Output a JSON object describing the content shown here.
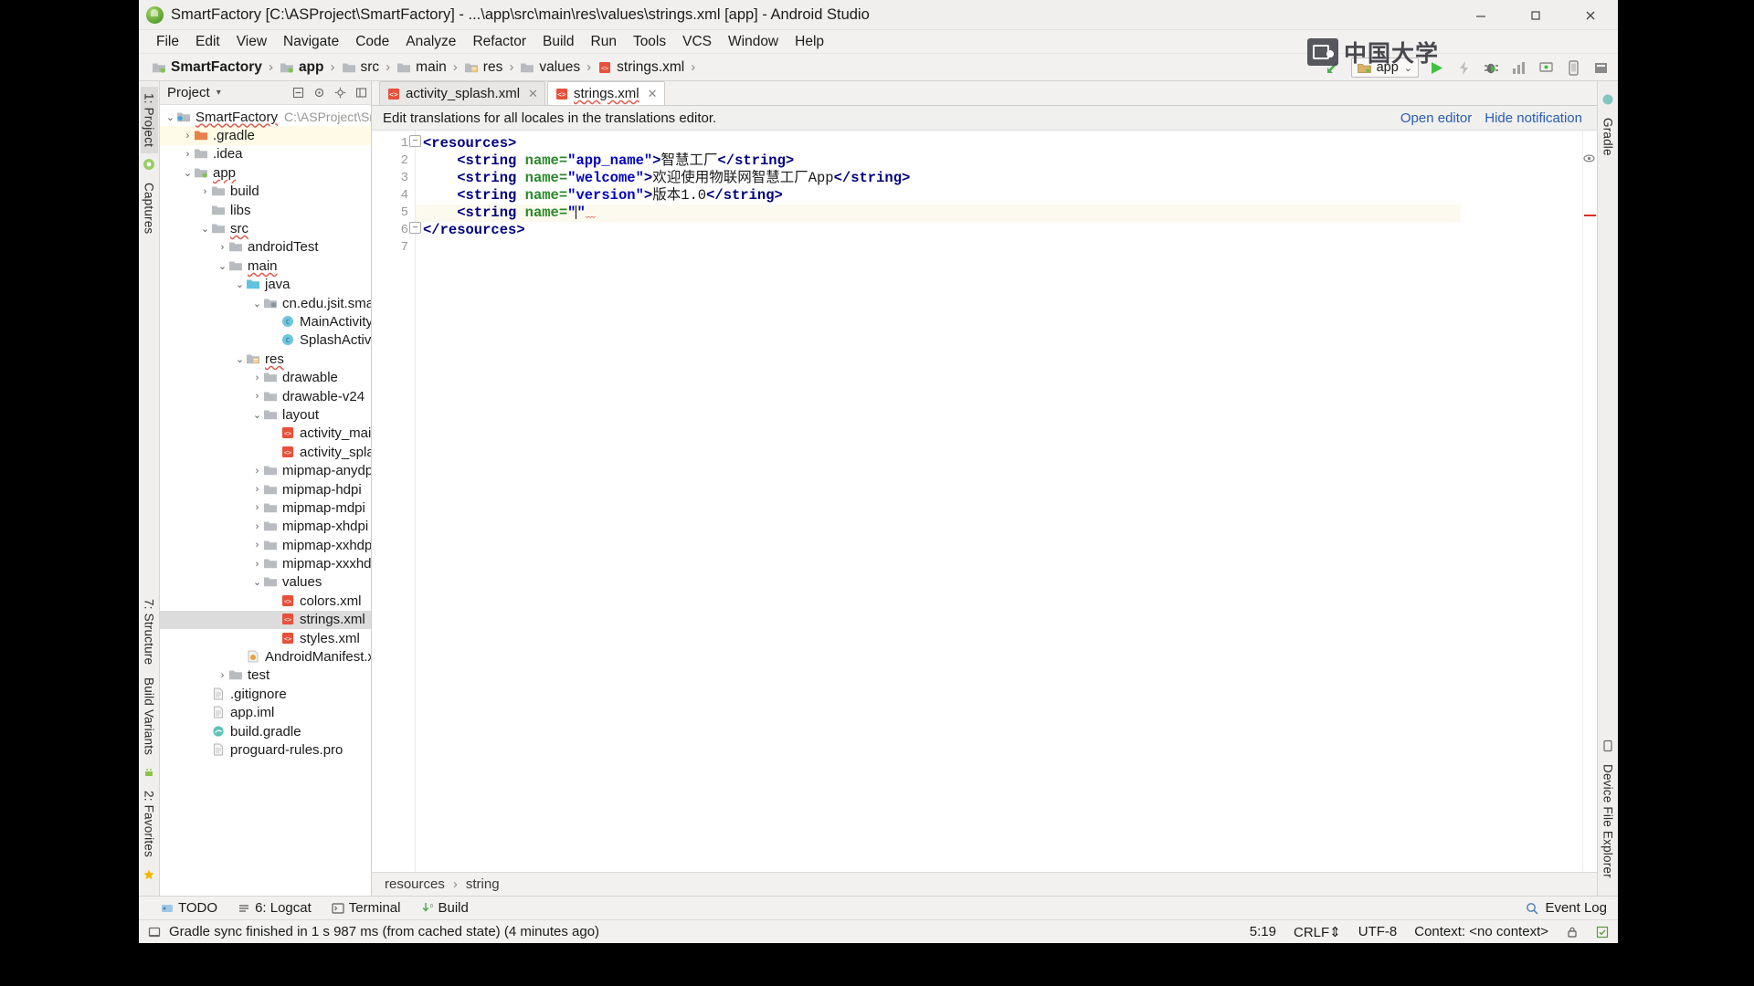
{
  "window": {
    "title": "SmartFactory [C:\\ASProject\\SmartFactory] - ...\\app\\src\\main\\res\\values\\strings.xml [app] - Android Studio",
    "minimize_label": "—",
    "maximize_label": "▢",
    "close_label": "✕"
  },
  "menubar": {
    "items": [
      "File",
      "Edit",
      "View",
      "Navigate",
      "Code",
      "Analyze",
      "Refactor",
      "Build",
      "Run",
      "Tools",
      "VCS",
      "Window",
      "Help"
    ]
  },
  "navbar": {
    "breadcrumbs": [
      {
        "label": "SmartFactory",
        "icon": "module-icon",
        "bold": true
      },
      {
        "label": "app",
        "icon": "module-icon",
        "bold": true
      },
      {
        "label": "src",
        "icon": "folder-icon",
        "bold": false
      },
      {
        "label": "main",
        "icon": "folder-icon",
        "bold": false
      },
      {
        "label": "res",
        "icon": "res-folder-icon",
        "bold": false
      },
      {
        "label": "values",
        "icon": "folder-icon",
        "bold": false
      },
      {
        "label": "strings.xml",
        "icon": "xml-file-icon",
        "bold": false
      }
    ],
    "run_config": "app",
    "icons": [
      "sync-project-icon",
      "run-icon",
      "apply-changes-icon",
      "debug-icon",
      "profiler-icon",
      "attach-debugger-icon",
      "avd-manager-icon",
      "sdk-manager-icon"
    ]
  },
  "left_strip": {
    "tabs": [
      {
        "label": "1: Project",
        "selected": true
      },
      {
        "label": "Captures",
        "selected": false
      },
      {
        "label": "7: Structure",
        "selected": false
      },
      {
        "label": "Build Variants",
        "selected": false
      },
      {
        "label": "2: Favorites",
        "selected": false
      }
    ]
  },
  "right_strip": {
    "tabs": [
      {
        "label": "Gradle"
      },
      {
        "label": "Device File Explorer"
      }
    ]
  },
  "project_panel": {
    "title": "Project",
    "actions": [
      "collapse-all-icon",
      "locate-icon",
      "settings-icon",
      "hide-icon"
    ],
    "tree": [
      {
        "label": "SmartFactory",
        "path": "C:\\ASProject\\Smar",
        "depth": 0,
        "arrow": "down",
        "icon": "project-icon",
        "state": "none",
        "wavy": true
      },
      {
        "label": ".gradle",
        "depth": 1,
        "arrow": "right",
        "icon": "gradle-folder-icon",
        "state": "yellow",
        "wavy": false
      },
      {
        "label": ".idea",
        "depth": 1,
        "arrow": "right",
        "icon": "folder-icon",
        "state": "none",
        "wavy": false
      },
      {
        "label": "app",
        "depth": 1,
        "arrow": "down",
        "icon": "module-icon",
        "state": "none",
        "wavy": true
      },
      {
        "label": "build",
        "depth": 2,
        "arrow": "right",
        "icon": "folder-icon",
        "state": "none",
        "wavy": false
      },
      {
        "label": "libs",
        "depth": 2,
        "arrow": "none",
        "icon": "folder-icon",
        "state": "none",
        "wavy": false
      },
      {
        "label": "src",
        "depth": 2,
        "arrow": "down",
        "icon": "folder-icon",
        "state": "none",
        "wavy": true
      },
      {
        "label": "androidTest",
        "depth": 3,
        "arrow": "right",
        "icon": "folder-icon",
        "state": "none",
        "wavy": false
      },
      {
        "label": "main",
        "depth": 3,
        "arrow": "down",
        "icon": "folder-icon",
        "state": "none",
        "wavy": true
      },
      {
        "label": "java",
        "depth": 4,
        "arrow": "down",
        "icon": "source-folder-icon",
        "state": "none",
        "wavy": false
      },
      {
        "label": "cn.edu.jsit.smar",
        "depth": 5,
        "arrow": "down",
        "icon": "package-icon",
        "state": "none",
        "wavy": false
      },
      {
        "label": "MainActivity",
        "depth": 6,
        "arrow": "none",
        "icon": "class-icon",
        "state": "none",
        "wavy": false
      },
      {
        "label": "SplashActivi",
        "depth": 6,
        "arrow": "none",
        "icon": "class-icon",
        "state": "none",
        "wavy": false
      },
      {
        "label": "res",
        "depth": 4,
        "arrow": "down",
        "icon": "res-folder-icon",
        "state": "none",
        "wavy": true
      },
      {
        "label": "drawable",
        "depth": 5,
        "arrow": "right",
        "icon": "folder-icon",
        "state": "none",
        "wavy": false
      },
      {
        "label": "drawable-v24",
        "depth": 5,
        "arrow": "right",
        "icon": "folder-icon",
        "state": "none",
        "wavy": false
      },
      {
        "label": "layout",
        "depth": 5,
        "arrow": "down",
        "icon": "folder-icon",
        "state": "none",
        "wavy": false
      },
      {
        "label": "activity_main",
        "depth": 6,
        "arrow": "none",
        "icon": "xml-file-icon",
        "state": "none",
        "wavy": false
      },
      {
        "label": "activity_spla",
        "depth": 6,
        "arrow": "none",
        "icon": "xml-file-icon",
        "state": "none",
        "wavy": false
      },
      {
        "label": "mipmap-anydpi",
        "depth": 5,
        "arrow": "right",
        "icon": "folder-icon",
        "state": "none",
        "wavy": false
      },
      {
        "label": "mipmap-hdpi",
        "depth": 5,
        "arrow": "right",
        "icon": "folder-icon",
        "state": "none",
        "wavy": false
      },
      {
        "label": "mipmap-mdpi",
        "depth": 5,
        "arrow": "right",
        "icon": "folder-icon",
        "state": "none",
        "wavy": false
      },
      {
        "label": "mipmap-xhdpi",
        "depth": 5,
        "arrow": "right",
        "icon": "folder-icon",
        "state": "none",
        "wavy": false
      },
      {
        "label": "mipmap-xxhdpi",
        "depth": 5,
        "arrow": "right",
        "icon": "folder-icon",
        "state": "none",
        "wavy": false
      },
      {
        "label": "mipmap-xxxhdp",
        "depth": 5,
        "arrow": "right",
        "icon": "folder-icon",
        "state": "none",
        "wavy": false
      },
      {
        "label": "values",
        "depth": 5,
        "arrow": "down",
        "icon": "folder-icon",
        "state": "none",
        "wavy": false
      },
      {
        "label": "colors.xml",
        "depth": 6,
        "arrow": "none",
        "icon": "xml-file-icon",
        "state": "none",
        "wavy": false
      },
      {
        "label": "strings.xml",
        "depth": 6,
        "arrow": "none",
        "icon": "xml-file-icon",
        "state": "grey",
        "wavy": false
      },
      {
        "label": "styles.xml",
        "depth": 6,
        "arrow": "none",
        "icon": "xml-file-icon",
        "state": "none",
        "wavy": false
      },
      {
        "label": "AndroidManifest.xm",
        "depth": 4,
        "arrow": "none",
        "icon": "manifest-icon",
        "state": "none",
        "wavy": false
      },
      {
        "label": "test",
        "depth": 3,
        "arrow": "right",
        "icon": "folder-icon",
        "state": "none",
        "wavy": false
      },
      {
        "label": ".gitignore",
        "depth": 2,
        "arrow": "none",
        "icon": "file-icon",
        "state": "none",
        "wavy": false
      },
      {
        "label": "app.iml",
        "depth": 2,
        "arrow": "none",
        "icon": "file-icon",
        "state": "none",
        "wavy": false
      },
      {
        "label": "build.gradle",
        "depth": 2,
        "arrow": "none",
        "icon": "gradle-file-icon",
        "state": "none",
        "wavy": false
      },
      {
        "label": "proguard-rules.pro",
        "depth": 2,
        "arrow": "none",
        "icon": "file-icon",
        "state": "none",
        "wavy": false
      }
    ]
  },
  "editor": {
    "tabs": [
      {
        "label": "activity_splash.xml",
        "active": false,
        "error": false,
        "icon": "xml-file-icon"
      },
      {
        "label": "strings.xml",
        "active": true,
        "error": true,
        "icon": "xml-file-icon"
      }
    ],
    "notification": {
      "message": "Edit translations for all locales in the translations editor.",
      "open_editor_link": "Open editor",
      "hide_link": "Hide notification"
    },
    "line_numbers": [
      "1",
      "2",
      "3",
      "4",
      "5",
      "6",
      "7"
    ],
    "lines": [
      {
        "n": 1,
        "indent": 0,
        "parts": [
          {
            "t": "tag",
            "s": "<resources>"
          }
        ],
        "current": false
      },
      {
        "n": 2,
        "indent": 1,
        "parts": [
          {
            "t": "tag",
            "s": "<string "
          },
          {
            "t": "attr",
            "s": "name="
          },
          {
            "t": "value",
            "s": "\"app_name\""
          },
          {
            "t": "tag",
            "s": ">"
          },
          {
            "t": "text",
            "s": "智慧工厂"
          },
          {
            "t": "tag",
            "s": "</string>"
          }
        ],
        "current": false
      },
      {
        "n": 3,
        "indent": 1,
        "parts": [
          {
            "t": "tag",
            "s": "<string "
          },
          {
            "t": "attr",
            "s": "name="
          },
          {
            "t": "value",
            "s": "\"welcome\""
          },
          {
            "t": "tag",
            "s": ">"
          },
          {
            "t": "text",
            "s": "欢迎使用物联网智慧工厂App"
          },
          {
            "t": "tag",
            "s": "</string>"
          }
        ],
        "current": false
      },
      {
        "n": 4,
        "indent": 1,
        "parts": [
          {
            "t": "tag",
            "s": "<string "
          },
          {
            "t": "attr",
            "s": "name="
          },
          {
            "t": "value",
            "s": "\"version\""
          },
          {
            "t": "tag",
            "s": ">"
          },
          {
            "t": "text",
            "s": "版本1.0"
          },
          {
            "t": "tag",
            "s": "</string>"
          }
        ],
        "current": false
      },
      {
        "n": 5,
        "indent": 1,
        "parts": [
          {
            "t": "tag",
            "s": "<string "
          },
          {
            "t": "attr",
            "s": "name="
          },
          {
            "t": "value",
            "s": "\""
          },
          {
            "t": "caret",
            "s": ""
          },
          {
            "t": "value",
            "s": "\""
          }
        ],
        "current": true
      },
      {
        "n": 6,
        "indent": 0,
        "parts": [
          {
            "t": "tag",
            "s": "</resources>"
          }
        ],
        "current": false
      },
      {
        "n": 7,
        "indent": 0,
        "parts": [],
        "current": false
      }
    ],
    "breadcrumb_bottom": [
      "resources",
      "string"
    ]
  },
  "bottom_bar": {
    "items": [
      {
        "label": "TODO",
        "icon": "todo-icon"
      },
      {
        "label": "6: Logcat",
        "icon": "logcat-icon"
      },
      {
        "label": "Terminal",
        "icon": "terminal-icon"
      },
      {
        "label": "Build",
        "icon": "build-icon"
      }
    ],
    "event_log": "Event Log",
    "event_log_icon": "event-log-icon"
  },
  "status_bar": {
    "message": "Gradle sync finished in 1 s 987 ms (from cached state) (4 minutes ago)",
    "caret_position": "5:19",
    "line_separator": "CRLF⇕",
    "encoding": "UTF-8",
    "context": "Context: <no context>",
    "icons": [
      "lock-icon",
      "inspection-icon"
    ]
  },
  "watermark": {
    "text": "中国大学"
  },
  "colors": {
    "accent_blue": "#2a5db0",
    "tag_color": "#000080",
    "attr_color": "#2a8a2a",
    "value_color": "#0000c0",
    "error_red": "#d93025",
    "chrome_bg": "#f2f1f0",
    "editor_bg": "#ffffff",
    "current_line": "#fcfaef",
    "selection_grey": "#dcdcdc",
    "selection_yellow": "#fffbe6"
  }
}
